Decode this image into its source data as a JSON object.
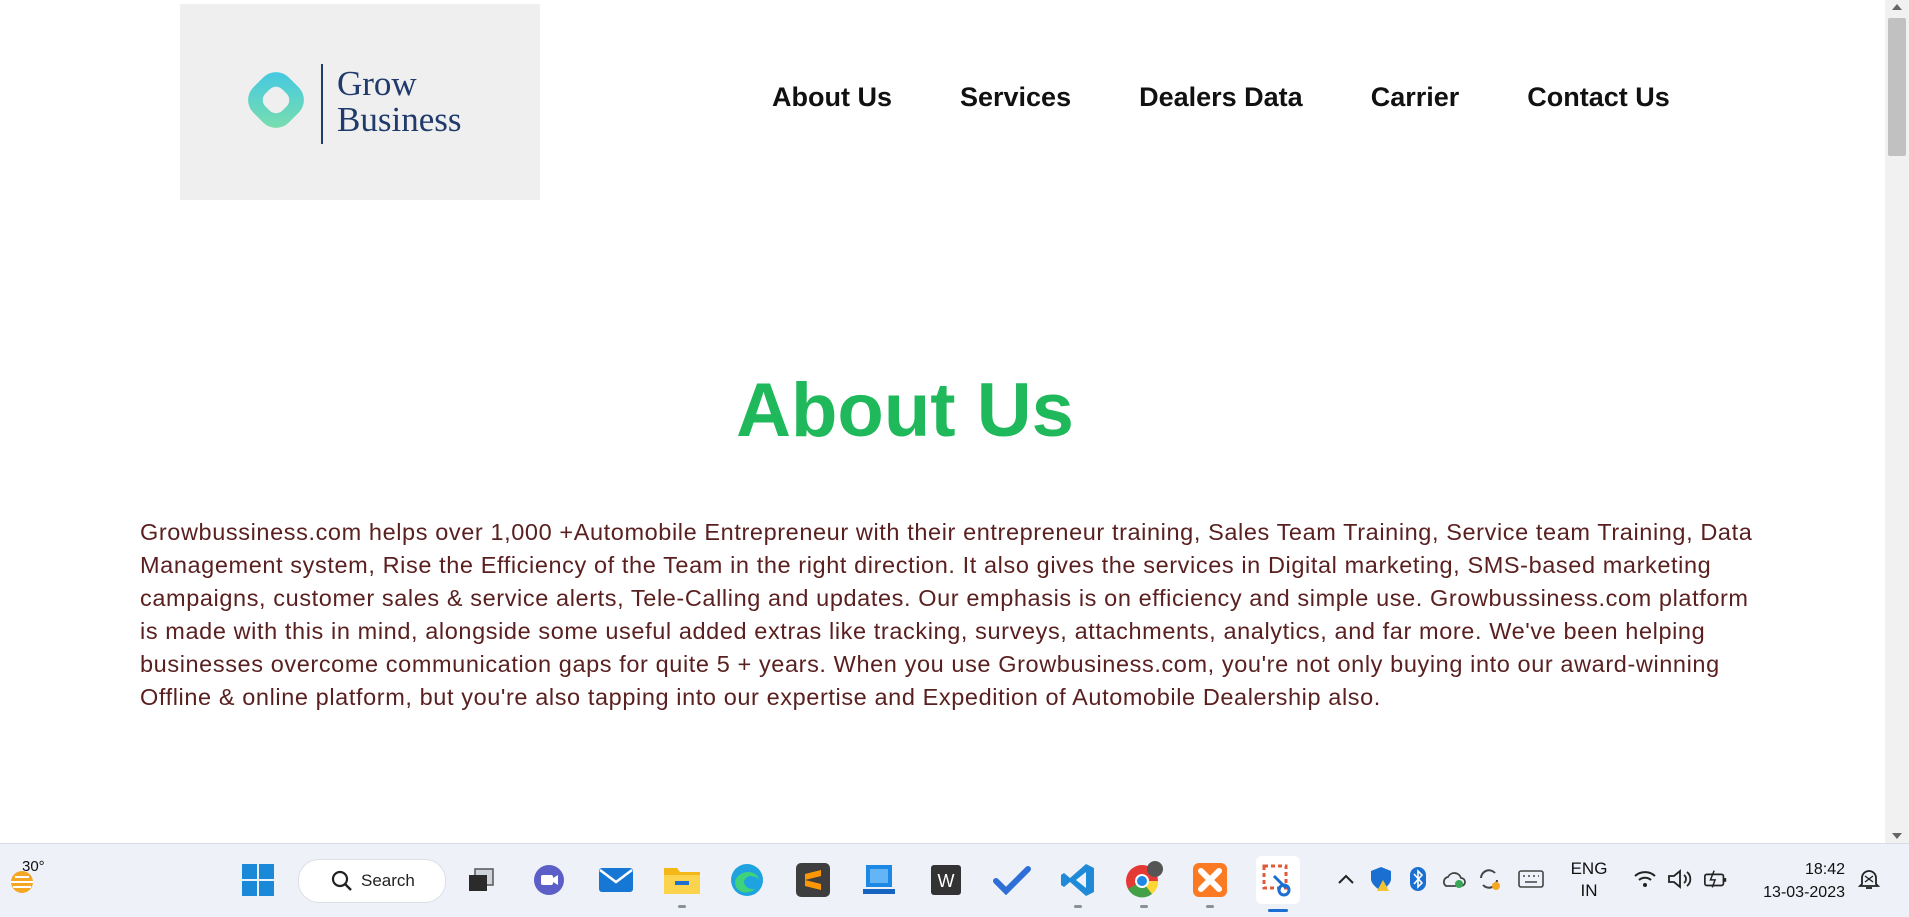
{
  "header": {
    "logo_line1": "Grow",
    "logo_line2": "Business",
    "nav": [
      {
        "label": "About Us"
      },
      {
        "label": "Services"
      },
      {
        "label": "Dealers Data"
      },
      {
        "label": "Carrier"
      },
      {
        "label": "Contact Us"
      }
    ]
  },
  "main": {
    "title": "About Us",
    "body": "Growbussiness.com helps over 1,000 +Automobile Entrepreneur with their entrepreneur training, Sales Team Training, Service team Training, Data Management system, Rise the Efficiency of the Team in the right direction. It also gives the services in Digital marketing, SMS-based marketing campaigns, customer sales & service alerts, Tele-Calling and updates. Our emphasis is on efficiency and simple use. Growbussiness.com platform is made with this in mind, alongside some useful added extras like tracking, surveys, attachments, analytics, and far more. We've been helping businesses overcome communication gaps for quite 5 + years. When you use Growbusiness.com, you're not only buying into our award-winning Offline & online platform, but you're also tapping into our expertise and Expedition of Automobile Dealership also."
  },
  "colors": {
    "title": "#1fb85a",
    "body_text": "#5a2020",
    "logo_text": "#1f3a6b",
    "logo_box": "#efefef"
  },
  "taskbar": {
    "weather_temp": "30°",
    "search_label": "Search",
    "apps": [
      {
        "icon": "windows-start-icon"
      },
      {
        "icon": "task-view-icon"
      },
      {
        "icon": "teams-chat-icon"
      },
      {
        "icon": "mail-icon"
      },
      {
        "icon": "file-explorer-icon"
      },
      {
        "icon": "edge-icon"
      },
      {
        "icon": "sublime-text-icon"
      },
      {
        "icon": "desktop-app-icon"
      },
      {
        "icon": "w-app-icon"
      },
      {
        "icon": "todo-icon"
      },
      {
        "icon": "vscode-icon"
      },
      {
        "icon": "chrome-icon"
      },
      {
        "icon": "xampp-icon"
      },
      {
        "icon": "snipping-tool-icon"
      }
    ],
    "language_line1": "ENG",
    "language_line2": "IN",
    "time": "18:42",
    "date": "13-03-2023"
  }
}
